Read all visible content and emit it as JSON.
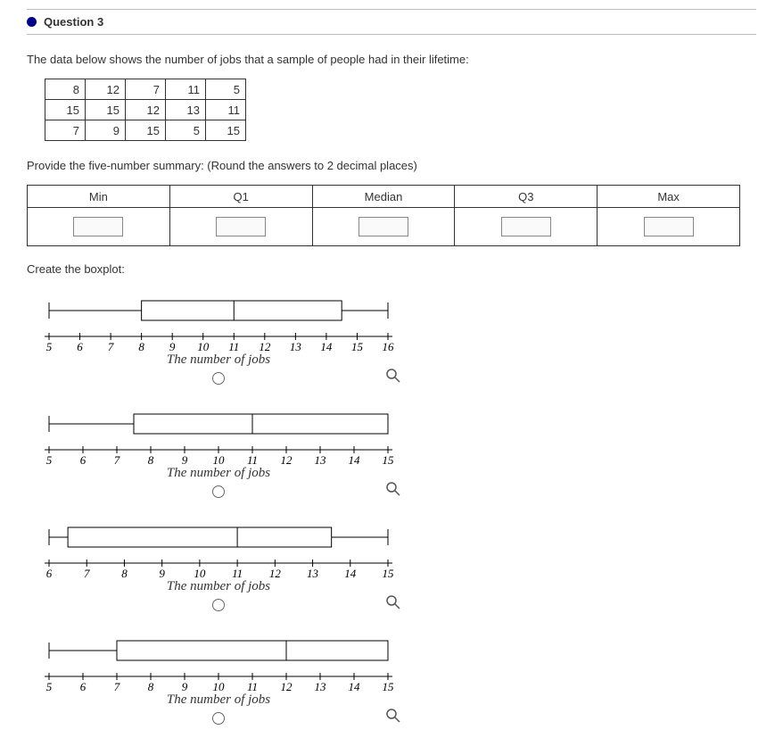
{
  "question": {
    "title": "Question 3",
    "prompt": "The data below shows the number of jobs that a sample of people had in their lifetime:",
    "data_rows": [
      [
        "8",
        "12",
        "7",
        "11",
        "5"
      ],
      [
        "15",
        "15",
        "12",
        "13",
        "11"
      ],
      [
        "7",
        "9",
        "15",
        "5",
        "15"
      ]
    ],
    "summary_prompt": "Provide the five-number summary: (Round the answers to 2 decimal places)",
    "summary_headers": [
      "Min",
      "Q1",
      "Median",
      "Q3",
      "Max"
    ],
    "boxplot_prompt": "Create the boxplot:",
    "axis_label": "The number of jobs",
    "options": [
      {
        "axis_min": 5,
        "axis_max": 16,
        "ticks": [
          5,
          6,
          7,
          8,
          9,
          10,
          11,
          12,
          13,
          14,
          15,
          16
        ],
        "lw": 5,
        "q1": 8,
        "med": 11,
        "q3": 14.5,
        "rw": 16
      },
      {
        "axis_min": 5,
        "axis_max": 15,
        "ticks": [
          5,
          6,
          7,
          8,
          9,
          10,
          11,
          12,
          13,
          14,
          15
        ],
        "lw": 5,
        "q1": 7.5,
        "med": 11,
        "q3": 15,
        "rw": 15
      },
      {
        "axis_min": 6,
        "axis_max": 15,
        "ticks": [
          6,
          7,
          8,
          9,
          10,
          11,
          12,
          13,
          14,
          15
        ],
        "lw": 6,
        "q1": 6.5,
        "med": 11,
        "q3": 13.5,
        "rw": 15
      },
      {
        "axis_min": 5,
        "axis_max": 15,
        "ticks": [
          5,
          6,
          7,
          8,
          9,
          10,
          11,
          12,
          13,
          14,
          15
        ],
        "lw": 5,
        "q1": 7,
        "med": 12,
        "q3": 15,
        "rw": 15
      }
    ]
  }
}
